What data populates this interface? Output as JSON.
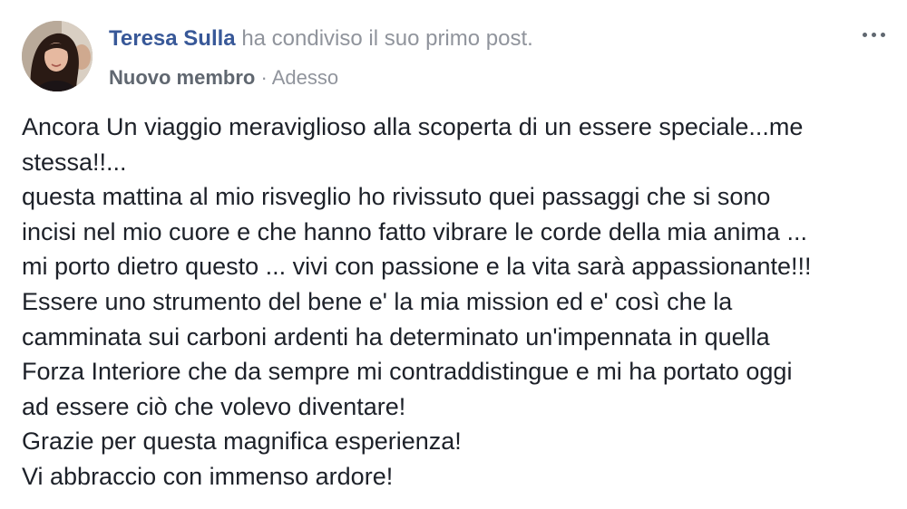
{
  "post": {
    "author_name": "Teresa Sulla",
    "action_text": "ha condiviso il suo primo post.",
    "member_badge": "Nuovo membro",
    "separator": "·",
    "timestamp": "Adesso",
    "more_icon": "more-horizontal-icon",
    "avatar_icon": "profile-photo",
    "body_lines": [
      "Ancora Un viaggio meraviglioso alla scoperta di un essere speciale...me",
      "stessa!!...",
      "questa mattina al mio risveglio ho rivissuto quei passaggi che si sono",
      "incisi nel mio cuore e che hanno fatto vibrare le corde della mia anima ...",
      "mi porto dietro questo ... vivi con passione e la vita sarà appassionante!!!",
      "Essere uno strumento del bene e' la mia mission ed e' così che la",
      "camminata sui carboni ardenti ha determinato un'impennata in quella",
      "Forza Interiore che da sempre mi contraddistingue e mi ha portato oggi",
      "ad essere ciò che volevo diventare!",
      "Grazie per questa magnifica esperienza!",
      "Vi abbraccio con immenso ardore!"
    ]
  },
  "colors": {
    "author_link": "#385898",
    "secondary_text": "#90949c",
    "badge_text": "#606770",
    "body_text": "#1d2129"
  }
}
